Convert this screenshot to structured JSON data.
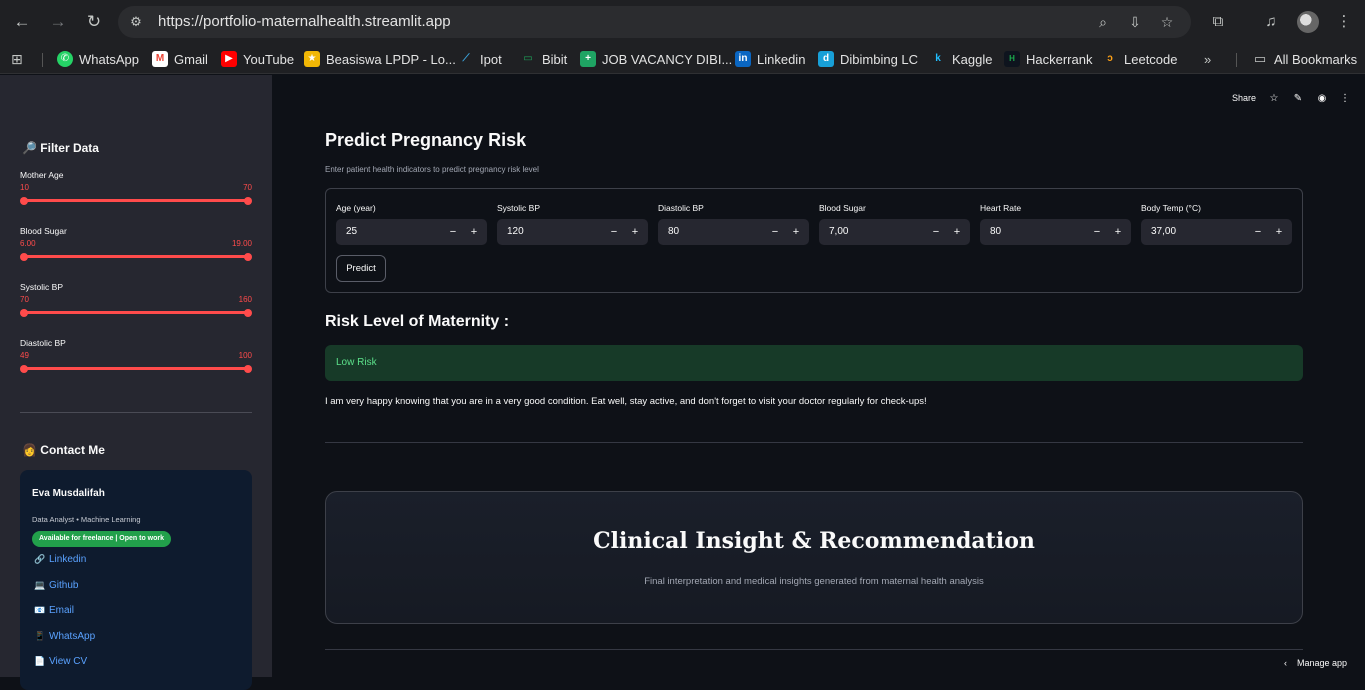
{
  "browser": {
    "url": "https://portfolio-maternalhealth.streamlit.app",
    "bookmarks": [
      {
        "label": "WhatsApp",
        "icon": "whatsapp-icon",
        "color": "#25d366"
      },
      {
        "label": "Gmail",
        "icon": "gmail-icon",
        "color": "#ea4335"
      },
      {
        "label": "YouTube",
        "icon": "youtube-icon",
        "color": "#ff0000"
      },
      {
        "label": "Beasiswa LPDP - Lo...",
        "icon": "lpdp-icon",
        "color": "#f2b705"
      },
      {
        "label": "Ipot",
        "icon": "ipot-icon",
        "color": "#3aa0d8"
      },
      {
        "label": "Bibit",
        "icon": "bibit-icon",
        "color": "#1ea35a"
      },
      {
        "label": "JOB VACANCY DIBI...",
        "icon": "sheets-icon",
        "color": "#1fa463"
      },
      {
        "label": "Linkedin",
        "icon": "linkedin-icon",
        "color": "#0a66c2"
      },
      {
        "label": "Dibimbing LC",
        "icon": "dibimbing-icon",
        "color": "#18a0d8"
      },
      {
        "label": "Kaggle",
        "icon": "kaggle-icon",
        "color": "#20beff"
      },
      {
        "label": "Hackerrank",
        "icon": "hackerrank-icon",
        "color": "#1ba94c"
      },
      {
        "label": "Leetcode",
        "icon": "leetcode-icon",
        "color": "#ffa116"
      }
    ],
    "all_bookmarks": "All Bookmarks"
  },
  "sidebar": {
    "filter_title": "Filter Data",
    "sliders": [
      {
        "label": "Mother Age",
        "min": "10",
        "max": "70"
      },
      {
        "label": "Blood Sugar",
        "min": "6.00",
        "max": "19.00"
      },
      {
        "label": "Systolic BP",
        "min": "70",
        "max": "160"
      },
      {
        "label": "Diastolic BP",
        "min": "49",
        "max": "100"
      }
    ],
    "contact_title": "Contact Me",
    "contact": {
      "name": "Eva Musdalifah",
      "role": "Data Analyst • Machine Learning",
      "badge": "Available for freelance | Open to work",
      "links": [
        {
          "label": "Linkedin",
          "icon": "🔗"
        },
        {
          "label": "Github",
          "icon": "💻"
        },
        {
          "label": "Email",
          "icon": "📧"
        },
        {
          "label": "WhatsApp",
          "icon": "📱"
        },
        {
          "label": "View CV",
          "icon": "📄"
        }
      ]
    }
  },
  "header": {
    "share": "Share"
  },
  "main": {
    "title": "Predict Pregnancy Risk",
    "subtitle": "Enter patient health indicators to predict pregnancy risk level",
    "inputs": [
      {
        "label": "Age (year)",
        "value": "25"
      },
      {
        "label": "Systolic BP",
        "value": "120"
      },
      {
        "label": "Diastolic BP",
        "value": "80"
      },
      {
        "label": "Blood Sugar",
        "value": "7,00"
      },
      {
        "label": "Heart Rate",
        "value": "80"
      },
      {
        "label": "Body Temp (°C)",
        "value": "37,00"
      }
    ],
    "predict_label": "Predict",
    "risk_heading": "Risk Level of Maternity :",
    "risk_result": "Low Risk",
    "message": "I am very happy knowing that you are in a very good condition. Eat well, stay active, and don't forget to visit your doctor regularly for check-ups!",
    "insight_title": "Clinical Insight & Recommendation",
    "insight_subtitle": "Final interpretation and medical insights generated from maternal health analysis"
  },
  "footer": {
    "manage_app": "Manage app"
  }
}
